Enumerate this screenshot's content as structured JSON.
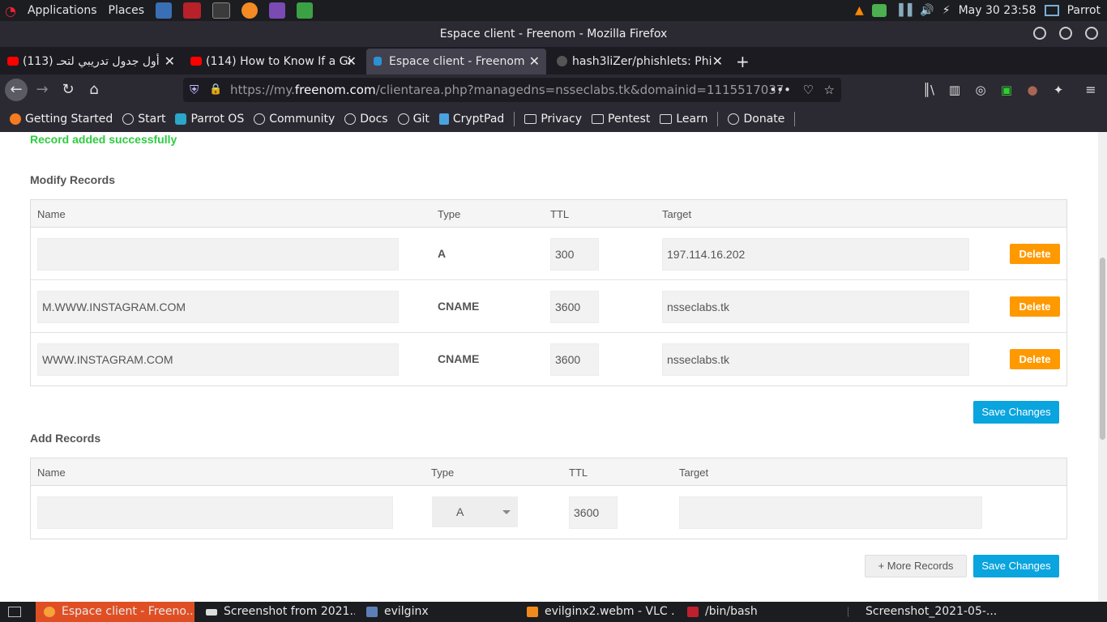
{
  "system_bar": {
    "applications": "Applications",
    "places": "Places",
    "datetime": "May 30  23:58",
    "user": "Parrot"
  },
  "window": {
    "title": "Espace client - Freenom - Mozilla Firefox"
  },
  "tabs": [
    {
      "label": "(113) أول جدول تدريبي لتحـ"
    },
    {
      "label": "(114) How to Know If a Gi"
    },
    {
      "label": "Espace client - Freenom"
    },
    {
      "label": "hash3liZer/phishlets: Phi"
    }
  ],
  "url": {
    "prefix": "https://my.",
    "domain": "freenom.com",
    "suffix": "/clientarea.php?managedns=nsseclabs.tk&domainid=1115517037"
  },
  "bookmarks": [
    {
      "label": "Getting Started"
    },
    {
      "label": "Start"
    },
    {
      "label": "Parrot OS"
    },
    {
      "label": "Community"
    },
    {
      "label": "Docs"
    },
    {
      "label": "Git"
    },
    {
      "label": "CryptPad"
    },
    {
      "label": "Privacy"
    },
    {
      "label": "Pentest"
    },
    {
      "label": "Learn"
    },
    {
      "label": "Donate"
    }
  ],
  "page": {
    "success_message": "Record added successfully",
    "modify_title": "Modify Records",
    "add_title": "Add Records",
    "columns": {
      "name": "Name",
      "type": "Type",
      "ttl": "TTL",
      "target": "Target"
    },
    "records": [
      {
        "name": "",
        "type": "A",
        "ttl": "300",
        "target": "197.114.16.202"
      },
      {
        "name": "M.WWW.INSTAGRAM.COM",
        "type": "CNAME",
        "ttl": "3600",
        "target": "nsseclabs.tk"
      },
      {
        "name": "WWW.INSTAGRAM.COM",
        "type": "CNAME",
        "ttl": "3600",
        "target": "nsseclabs.tk"
      }
    ],
    "delete_label": "Delete",
    "save_label": "Save Changes",
    "more_records_label": "+ More Records",
    "new_record": {
      "name": "",
      "type": "A",
      "ttl": "3600",
      "target": ""
    }
  },
  "taskbar": [
    {
      "label": "Espace client - Freeno..."
    },
    {
      "label": "Screenshot from 2021..."
    },
    {
      "label": "evilginx"
    },
    {
      "label": "evilginx2.webm - VLC ..."
    },
    {
      "label": "/bin/bash"
    },
    {
      "label": "Screenshot_2021-05-..."
    }
  ],
  "colors": {
    "success": "#2ecc40",
    "delete": "#ff9900",
    "save": "#0aa4de",
    "active_task": "#e04f24"
  }
}
